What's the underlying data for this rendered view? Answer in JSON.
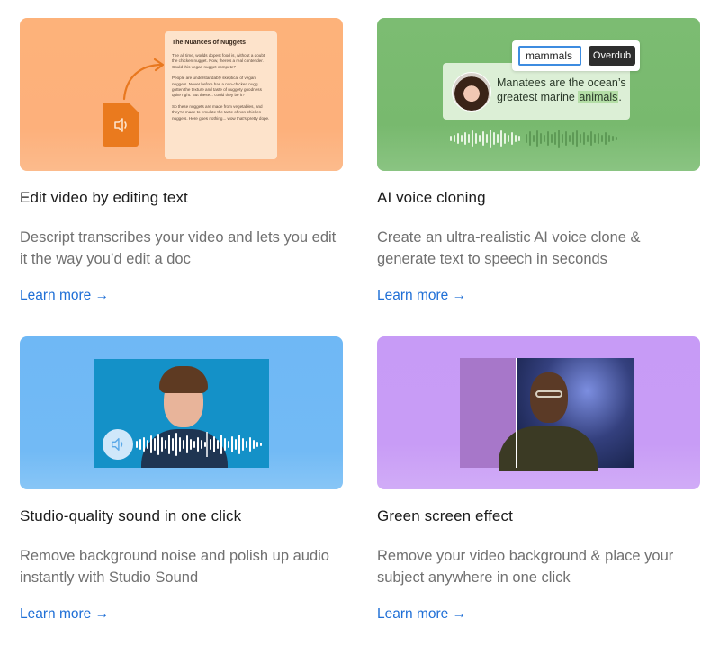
{
  "cards": [
    {
      "title": "Edit video by editing text",
      "description": "Descript transcribes your video and lets you edit it the way you’d edit a doc",
      "link": "Learn more →",
      "color": "#fdb27a",
      "doc": {
        "title": "The Nuances of Nuggets",
        "paragraphs": [
          "The all time, worlds dopest food is, without a doubt, the chicken nugget. Now, there's a real contender. Could this vegan nugget compete?",
          "People are understandably skeptical of vegan nuggets. Never before has a non-chicken nugg gotten the texture and taste of nuggety goodness quite right. But these... could they be it?",
          "So these nuggets are made from vegetables, and they're made to emulate the taste of non-chicken nuggets. Here goes nothing... wow that's pretty dope."
        ]
      }
    },
    {
      "title": "AI voice cloning",
      "description": "Create an ultra-realistic AI voice clone & generate text to speech in seconds",
      "link": "Learn more →",
      "color": "#7cbc72",
      "overdub": {
        "word": "mammals",
        "button": "Overdub",
        "sentence_before": "Manatees are the ocean’s greatest marine ",
        "highlight": "animals",
        "sentence_after": "."
      }
    },
    {
      "title": "Studio-quality sound in one click",
      "description": "Remove background noise and polish up audio instantly with Studio Sound",
      "link": "Learn more →",
      "color": "#6fb8f5"
    },
    {
      "title": "Green screen effect",
      "description": "Remove your video background & place your subject anywhere in one click",
      "link": "Learn more →",
      "color": "#c79bf6"
    }
  ]
}
